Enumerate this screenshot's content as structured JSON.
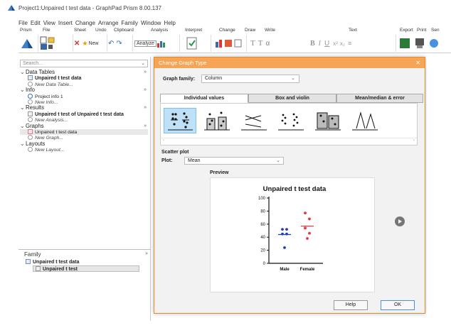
{
  "app": {
    "title": "Project1:Unpaired t test data - GraphPad Prism 8.00.137"
  },
  "menu": [
    "File",
    "Edit",
    "View",
    "Insert",
    "Change",
    "Arrange",
    "Family",
    "Window",
    "Help"
  ],
  "ribbon": {
    "groups": [
      "Prism",
      "File",
      "Sheet",
      "Undo",
      "Clipboard",
      "Analysis",
      "Interpret",
      "Change",
      "Draw",
      "Write",
      "Text",
      "Export",
      "Print",
      "Sen"
    ],
    "new_label": "New",
    "analyze_label": "Analyze"
  },
  "sidebar": {
    "search_placeholder": "Search...",
    "sections": [
      {
        "label": "Data Tables",
        "items": [
          {
            "label": "Unpaired t test data",
            "kind": "bold"
          },
          {
            "label": "New Data Table...",
            "kind": "new"
          }
        ]
      },
      {
        "label": "Info",
        "items": [
          {
            "label": "Project info 1",
            "kind": "plain"
          },
          {
            "label": "New Info...",
            "kind": "new"
          }
        ]
      },
      {
        "label": "Results",
        "items": [
          {
            "label": "Unpaired t test of Unpaired t test data",
            "kind": "bold"
          },
          {
            "label": "New Analysis...",
            "kind": "new"
          }
        ]
      },
      {
        "label": "Graphs",
        "items": [
          {
            "label": "Unpaired t test data",
            "kind": "plain"
          },
          {
            "label": "New Graph...",
            "kind": "new"
          }
        ]
      },
      {
        "label": "Layouts",
        "items": [
          {
            "label": "New Layout...",
            "kind": "new"
          }
        ]
      }
    ],
    "family_header": "Family",
    "family_items": [
      "Unpaired t test data",
      "Unpaired t test"
    ]
  },
  "dialog": {
    "title": "Change Graph Type",
    "family_label": "Graph family:",
    "family_value": "Column",
    "tabs": [
      "Individual values",
      "Box and violin",
      "Mean/median & error"
    ],
    "active_tab": 0,
    "section_label": "Scatter plot",
    "plot_label": "Plot:",
    "plot_value": "Mean",
    "preview_label": "Preview",
    "help_button": "Help",
    "ok_button": "OK"
  },
  "chart_data": {
    "type": "scatter",
    "title": "Unpaired t test data",
    "categories": [
      "Male",
      "Female"
    ],
    "ylim": [
      0,
      100
    ],
    "yticks": [
      0,
      20,
      40,
      60,
      80,
      100
    ],
    "series": [
      {
        "category": "Male",
        "values": [
          52,
          52,
          45,
          45,
          24
        ],
        "mean": 44,
        "color": "#1f3fbf"
      },
      {
        "category": "Female",
        "values": [
          77,
          68,
          54,
          46,
          38
        ],
        "mean": 57,
        "color": "#e8333a"
      }
    ]
  }
}
